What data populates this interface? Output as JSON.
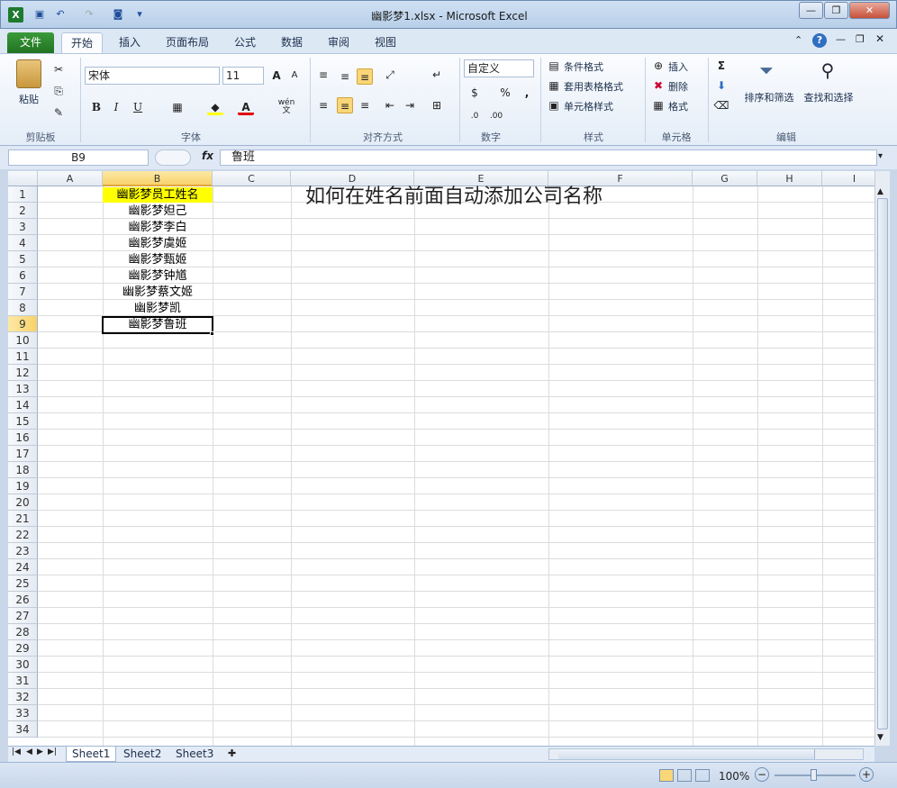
{
  "window": {
    "title": "幽影梦1.xlsx - Microsoft Excel"
  },
  "tabs": [
    "文件",
    "开始",
    "插入",
    "页面布局",
    "公式",
    "数据",
    "审阅",
    "视图"
  ],
  "ribbon": {
    "clipboard": {
      "paste": "粘贴",
      "group": "剪贴板"
    },
    "font": {
      "name": "宋体",
      "size": "11",
      "group": "字体",
      "bold": "B",
      "italic": "I",
      "underline": "U",
      "phonetic": "wén 文"
    },
    "alignment": {
      "group": "对齐方式"
    },
    "number": {
      "format": "自定义",
      "group": "数字",
      "percent": "%",
      "comma": ","
    },
    "styles": {
      "conditional": "条件格式",
      "table": "套用表格格式",
      "cell": "单元格样式",
      "group": "样式"
    },
    "cells": {
      "insert": "插入",
      "delete": "删除",
      "format": "格式",
      "group": "单元格"
    },
    "editing": {
      "sum": "Σ",
      "sort": "排序和筛选",
      "find": "查找和选择",
      "group": "编辑"
    }
  },
  "formula_bar": {
    "name_box": "B9",
    "fx": "fx",
    "value": "鲁班"
  },
  "sheet": {
    "columns": [
      "A",
      "B",
      "C",
      "D",
      "E",
      "F",
      "G",
      "H",
      "I"
    ],
    "rows": [
      "1",
      "2",
      "3",
      "4",
      "5",
      "6",
      "7",
      "8",
      "9",
      "10",
      "11",
      "12",
      "13",
      "14",
      "15",
      "16",
      "17",
      "18",
      "19",
      "20",
      "21",
      "22",
      "23",
      "24",
      "25",
      "26",
      "27",
      "28",
      "29",
      "30",
      "31",
      "32",
      "33",
      "34"
    ],
    "header_cell": "幽影梦员工姓名",
    "names": [
      "幽影梦妲己",
      "幽影梦李白",
      "幽影梦虞姬",
      "幽影梦甄姬",
      "幽影梦钟馗",
      "幽影梦蔡文姬",
      "幽影梦凯",
      "幽影梦鲁班"
    ],
    "heading": "如何在姓名前面自动添加公司名称",
    "highlight_color": "#ffff00"
  },
  "sheet_tabs": [
    "Sheet1",
    "Sheet2",
    "Sheet3"
  ],
  "status": {
    "zoom": "100%"
  }
}
